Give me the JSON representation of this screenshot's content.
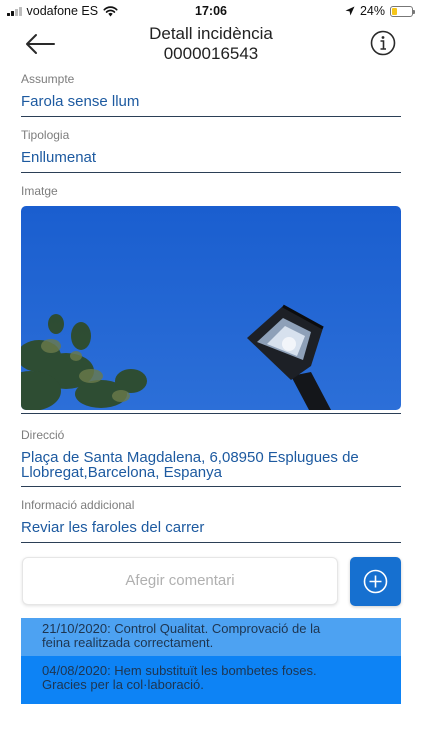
{
  "status_bar": {
    "carrier": "vodafone ES",
    "time": "17:06",
    "battery_text": "24%",
    "battery_level": 0.24,
    "battery_color": "#f5c518"
  },
  "header": {
    "title_line1": "Detall incidència",
    "title_line2": "0000016543",
    "back_icon": "arrow-left-icon",
    "info_icon": "info-circle-icon"
  },
  "fields": {
    "subject": {
      "label": "Assumpte",
      "value": "Farola sense llum"
    },
    "type": {
      "label": "Tipologia",
      "value": "Enllumenat"
    },
    "image": {
      "label": "Imatge"
    },
    "address": {
      "label": "Direcció",
      "line1": "Plaça de Santa Magdalena, 6,08950 Esplugues de",
      "line2": "Llobregat,Barcelona, Espanya"
    },
    "additional": {
      "label": "Informació addicional",
      "value": "Reviar les faroles del carrer"
    }
  },
  "comment_box": {
    "placeholder": "Afegir comentari",
    "add_icon": "plus-circle-icon"
  },
  "comments": [
    {
      "line1": "21/10/2020: Control Qualitat. Comprovació de la",
      "line2": "feina realitzada correctament."
    },
    {
      "line1": "04/08/2020: Hem substituït les bombetes foses.",
      "line2": "Gracies per la col·laboració."
    }
  ],
  "colors": {
    "accent": "#1670d0",
    "field_value": "#1d5aa0",
    "comment_light": "#4da2f2",
    "comment_dark": "#0d83f5"
  }
}
